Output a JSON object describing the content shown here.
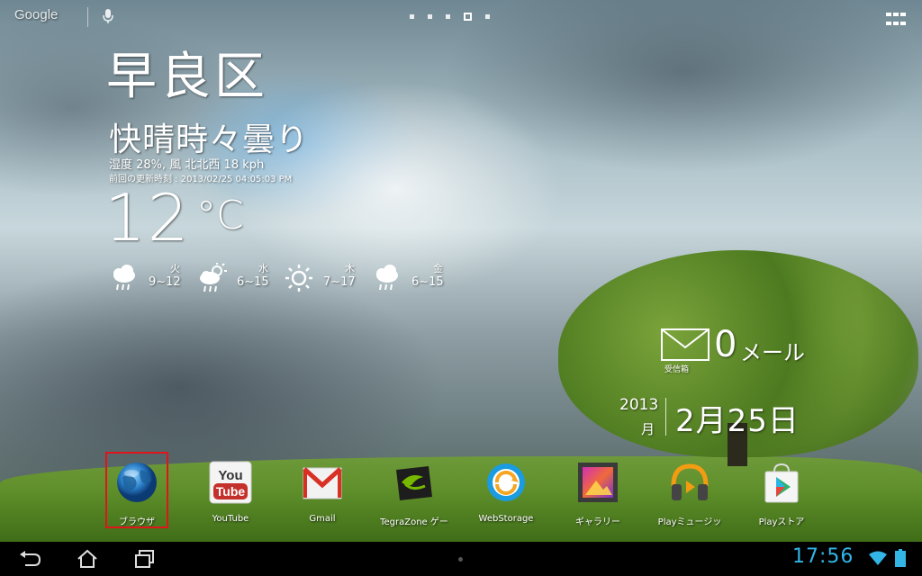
{
  "topbar": {
    "google_label": "Google",
    "page_count": 5,
    "active_page": 4
  },
  "weather": {
    "city": "早良区",
    "condition": "快晴時々曇り",
    "humidity_wind": "湿度 28%, 風 北北西 18 kph",
    "updated": "前回の更新時刻 : 2013/02/25 04:05:03 PM",
    "temperature": "12",
    "unit": "°C",
    "forecast": [
      {
        "day": "火",
        "range": "9~12",
        "icon": "cloud-rain-icon"
      },
      {
        "day": "水",
        "range": "6~15",
        "icon": "sun-cloud-rain-icon"
      },
      {
        "day": "木",
        "range": "7~17",
        "icon": "sun-icon"
      },
      {
        "day": "金",
        "range": "6~15",
        "icon": "cloud-rain-icon"
      }
    ]
  },
  "mail": {
    "count": "0",
    "label": "メール",
    "inbox_label": "受信箱"
  },
  "date": {
    "year": "2013",
    "month_char": "月",
    "main": "2月25日"
  },
  "dock": [
    {
      "label": "ブラウザ",
      "icon": "browser-globe-icon"
    },
    {
      "label": "YouTube",
      "icon": "youtube-icon"
    },
    {
      "label": "Gmail",
      "icon": "gmail-icon"
    },
    {
      "label": "TegraZone ゲー",
      "icon": "tegrazone-icon"
    },
    {
      "label": "WebStorage",
      "icon": "webstorage-icon"
    },
    {
      "label": "ギャラリー",
      "icon": "gallery-icon"
    },
    {
      "label": "Playミュージッ",
      "icon": "play-music-icon"
    },
    {
      "label": "Playストア",
      "icon": "play-store-icon"
    }
  ],
  "statusbar": {
    "time": "17:56",
    "clock_color": "#33b5e5"
  },
  "colors": {
    "highlight": "#e0141b"
  }
}
